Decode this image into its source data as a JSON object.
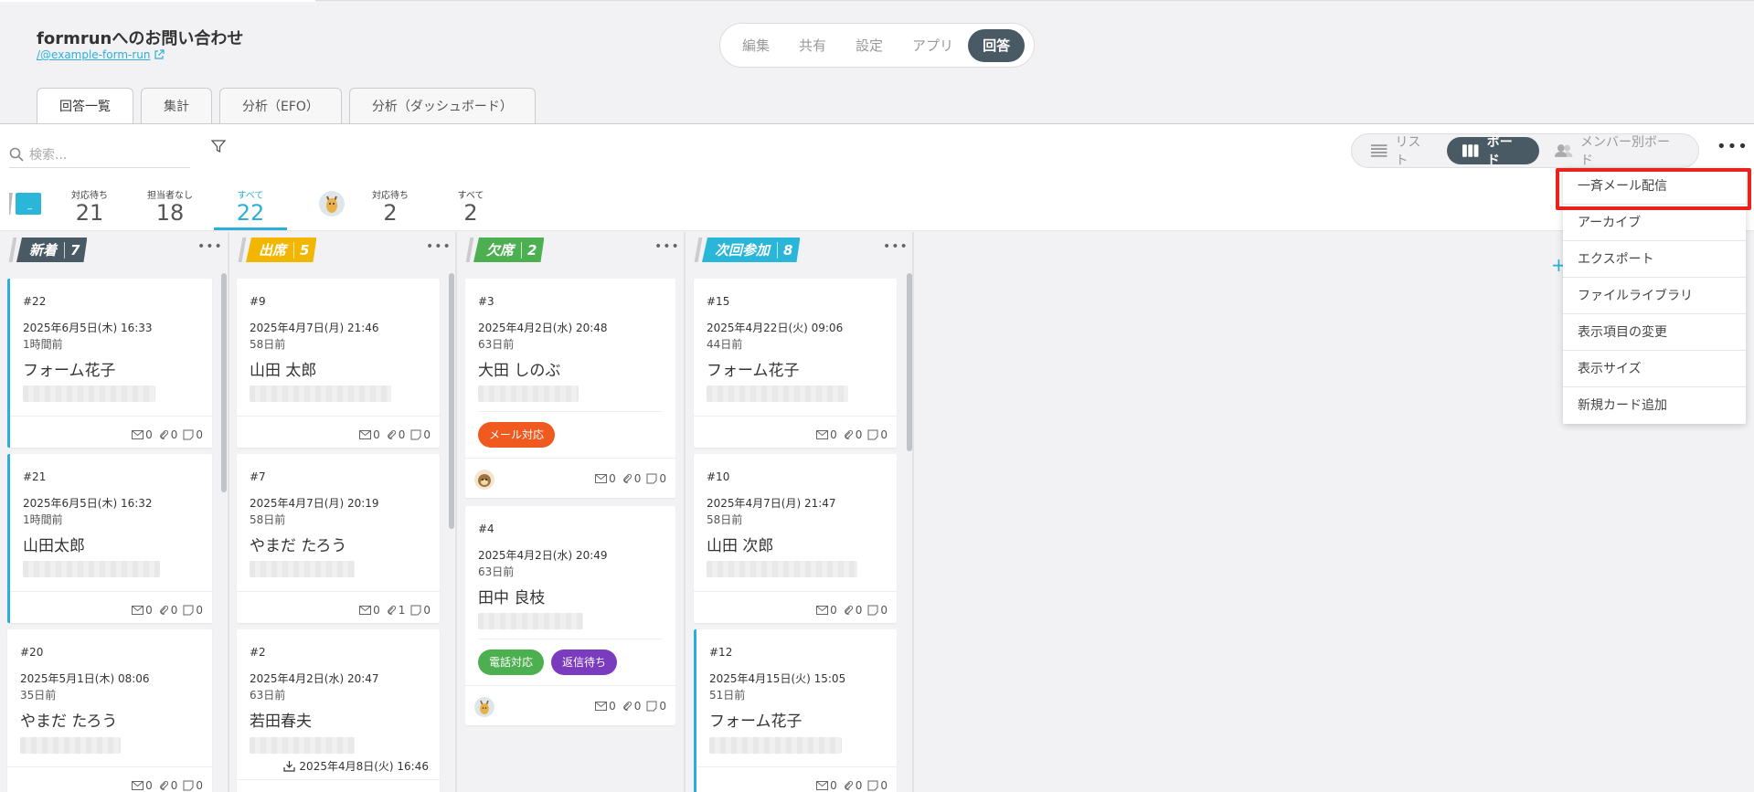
{
  "header": {
    "form_title": "formrunへのお問い合わせ",
    "form_link": "/@example-form-run"
  },
  "topnav": [
    "編集",
    "共有",
    "設定",
    "アプリ",
    "回答"
  ],
  "topnav_active": "回答",
  "tabs": [
    "回答一覧",
    "集計",
    "分析（EFO）",
    "分析（ダッシュボード）"
  ],
  "search": {
    "placeholder": "検索..."
  },
  "views": [
    "リスト",
    "ボード",
    "メンバー別ボード"
  ],
  "summary": {
    "team_label": "_",
    "team": [
      {
        "label": "対応待ち",
        "count": "21"
      },
      {
        "label": "担当者なし",
        "count": "18"
      },
      {
        "label": "すべて",
        "count": "22"
      }
    ],
    "me": [
      {
        "label": "対応待ち",
        "count": "2"
      },
      {
        "label": "すべて",
        "count": "2"
      }
    ]
  },
  "columns": [
    {
      "label": "新着",
      "count": "7",
      "color": "#4a5a64",
      "cards": [
        {
          "id": "#22",
          "date": "2025年6月5日(木) 16:33",
          "ago": "1時間前",
          "name": "フォーム花子",
          "mail": "0",
          "clip": "0",
          "note": "0"
        },
        {
          "id": "#21",
          "date": "2025年6月5日(木) 16:32",
          "ago": "1時間前",
          "name": "山田太郎",
          "mail": "0",
          "clip": "0",
          "note": "0"
        },
        {
          "id": "#20",
          "date": "2025年5月1日(木) 08:06",
          "ago": "35日前",
          "name": "やまだ たろう",
          "mail": "0",
          "clip": "0",
          "note": "0"
        }
      ]
    },
    {
      "label": "出席",
      "count": "5",
      "color": "#f2b600",
      "cards": [
        {
          "id": "#9",
          "date": "2025年4月7日(月) 21:46",
          "ago": "58日前",
          "name": "山田 太郎",
          "mail": "0",
          "clip": "0",
          "note": "0"
        },
        {
          "id": "#7",
          "date": "2025年4月7日(月) 20:19",
          "ago": "58日前",
          "name": "やまだ たろう",
          "mail": "0",
          "clip": "1",
          "note": "0"
        },
        {
          "id": "#2",
          "date": "2025年4月2日(水) 20:47",
          "ago": "63日前",
          "name": "若田春夫",
          "sent": "2025年4月8日(火) 16:46"
        }
      ]
    },
    {
      "label": "欠席",
      "count": "2",
      "color": "#4caf50",
      "cards": [
        {
          "id": "#3",
          "date": "2025年4月2日(水) 20:48",
          "ago": "63日前",
          "name": "大田 しのぶ",
          "tags": [
            {
              "text": "メール対応",
              "color": "#f05a1e"
            }
          ],
          "mail": "0",
          "clip": "0",
          "note": "0"
        },
        {
          "id": "#4",
          "date": "2025年4月2日(水) 20:49",
          "ago": "63日前",
          "name": "田中 良枝",
          "tags": [
            {
              "text": "電話対応",
              "color": "#4caf50"
            },
            {
              "text": "返信待ち",
              "color": "#7a3bbf"
            }
          ],
          "mail": "0",
          "clip": "0",
          "note": "0"
        }
      ]
    },
    {
      "label": "次回参加",
      "count": "8",
      "color": "#29b6d8",
      "cards": [
        {
          "id": "#15",
          "date": "2025年4月22日(火) 09:06",
          "ago": "44日前",
          "name": "フォーム花子",
          "mail": "0",
          "clip": "0",
          "note": "0"
        },
        {
          "id": "#10",
          "date": "2025年4月7日(月) 21:47",
          "ago": "58日前",
          "name": "山田 次郎",
          "mail": "0",
          "clip": "0",
          "note": "0"
        },
        {
          "id": "#12",
          "date": "2025年4月15日(火) 15:05",
          "ago": "51日前",
          "name": "フォーム花子",
          "mail": "0",
          "clip": "0",
          "note": "0"
        }
      ]
    }
  ],
  "dropdown": [
    "一斉メール配信",
    "アーカイブ",
    "エクスポート",
    "ファイルライブラリ",
    "表示項目の変更",
    "表示サイズ",
    "新規カード追加"
  ],
  "colors": {
    "accent": "#2ab0d8",
    "dark": "#4a5a64",
    "highlight": "#e8231d"
  }
}
